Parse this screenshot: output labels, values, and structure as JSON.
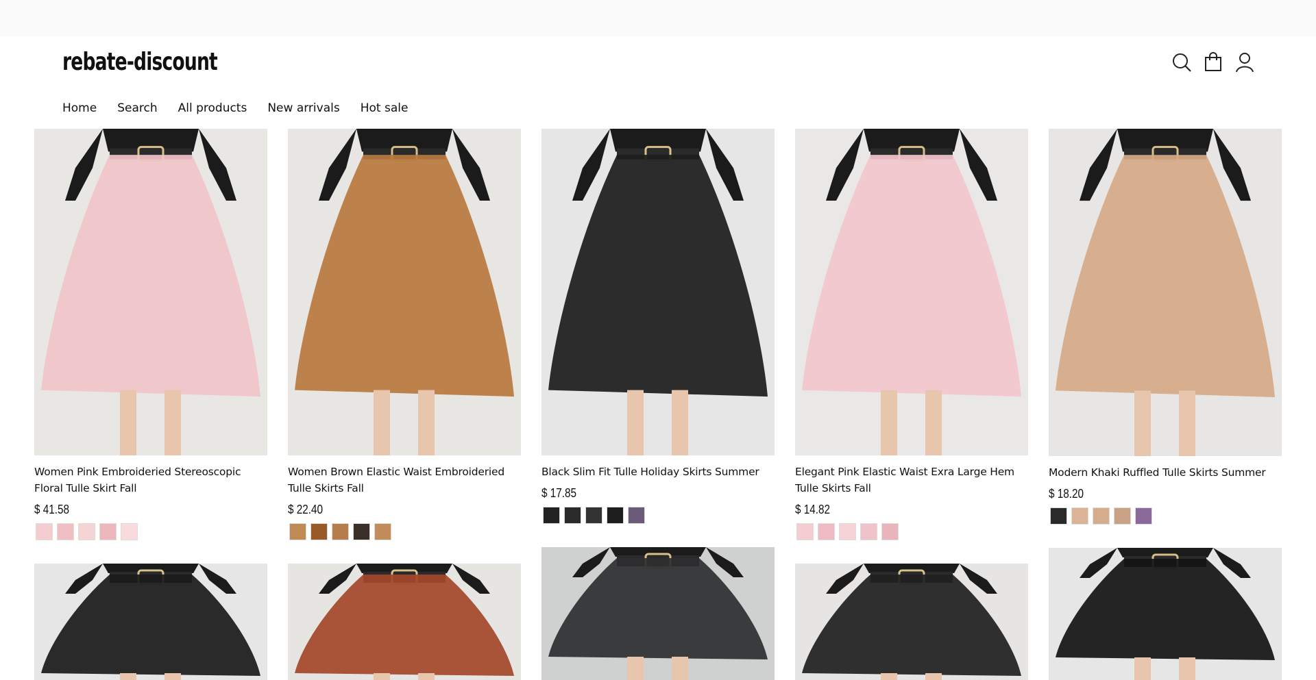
{
  "header": {
    "logo": "rebate-discount",
    "icons": [
      "search-icon",
      "cart-icon",
      "account-icon"
    ]
  },
  "nav": {
    "items": [
      "Home",
      "Search",
      "All products",
      "New arrivals",
      "Hot sale"
    ]
  },
  "products": [
    {
      "title": "Women Pink Embroideried Stereoscopic Floral Tulle Skirt Fall",
      "price": "$ 41.58",
      "bg": "#e9e7e4",
      "skirt": "#f0c4c8",
      "swatches": [
        "#f3cdd0",
        "#efbfc4",
        "#f5d4d6",
        "#ecb7bd",
        "#f8dbdc"
      ]
    },
    {
      "title": "Women Brown Elastic Waist Embroideried Tulle Skirts Fall",
      "price": "$ 22.40",
      "bg": "#e8e6e3",
      "skirt": "#b9793f",
      "swatches": [
        "#c08a55",
        "#9a5a27",
        "#b57d4b",
        "#3a2e28",
        "#c28c5a"
      ]
    },
    {
      "title": "Black Slim Fit Tulle Holiday Skirts Summer",
      "price": "$ 17.85",
      "bg": "#e6e6e6",
      "skirt": "#1c1c1c",
      "swatches": [
        "#222222",
        "#2a2a2a",
        "#333333",
        "#1e1e1e",
        "#6b5a7a"
      ]
    },
    {
      "title": "Elegant Pink Elastic Waist Exra Large Hem Tulle Skirts Fall",
      "price": "$ 14.82",
      "bg": "#e9e8e6",
      "skirt": "#f2c6cc",
      "swatches": [
        "#f3cdd2",
        "#eebbc3",
        "#f5d3d7",
        "#f0c2c9",
        "#eab4bd"
      ]
    },
    {
      "title": "Modern Khaki Ruffled Tulle Skirts Summer",
      "price": "$ 18.20",
      "bg": "#e7e6e4",
      "skirt": "#d6a987",
      "swatches": [
        "#2a2a2a",
        "#dcb396",
        "#d5ad8c",
        "#c9a286",
        "#8a6a9a"
      ]
    },
    {
      "bg": "#e6e6e6",
      "skirt": "#1a1a1a"
    },
    {
      "bg": "#e7e5e2",
      "skirt": "#a4472a"
    },
    {
      "bg": "#cfd0d0",
      "skirt": "#2e2e30"
    },
    {
      "bg": "#e6e5e3",
      "skirt": "#1f1f1f"
    },
    {
      "bg": "#e6e6e6",
      "skirt": "#141414"
    }
  ]
}
